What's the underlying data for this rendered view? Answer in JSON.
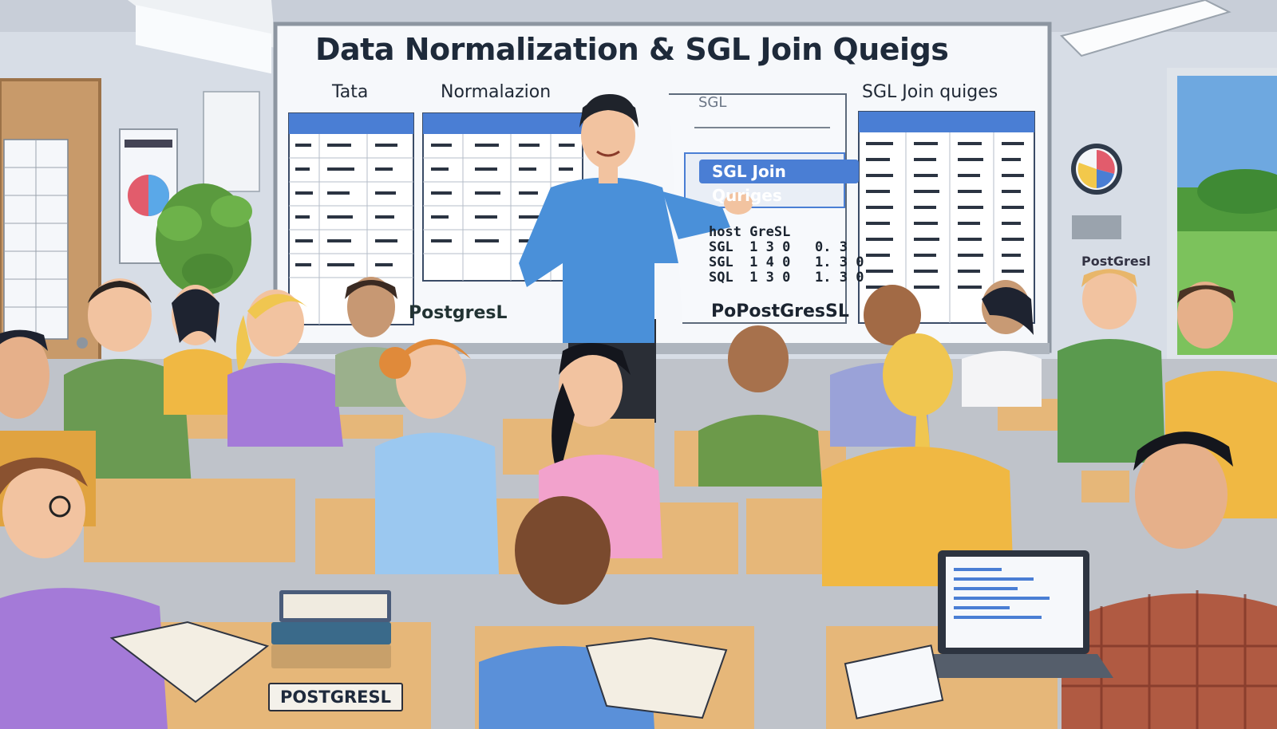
{
  "board": {
    "title": "Data Normalization & SGL Join Queigs",
    "subtitle_left": "Tata",
    "subtitle_mid": "Normalazion",
    "subtitle_right": "SGL Join quiges",
    "sql_header": "SGL",
    "sql_bar": "SGL Join Quriges",
    "sql_rows": "host GreSL\nSGL  1 3 0   0. 3\nSGL  1 4 0   1. 3 0\nSQL  1 3 0   1. 3 0",
    "sql_postgres": "PoPostGresSL",
    "postgres_left": "PostgresL",
    "postgres_right": "PostGresl"
  },
  "book": {
    "label": "POSTGRESL"
  },
  "colors": {
    "wall": "#d9dee6",
    "whiteboard": "#f6f8fb",
    "table_header": "#4a7ed4",
    "floor": "#b9bcc3",
    "desk": "#e6b779"
  }
}
